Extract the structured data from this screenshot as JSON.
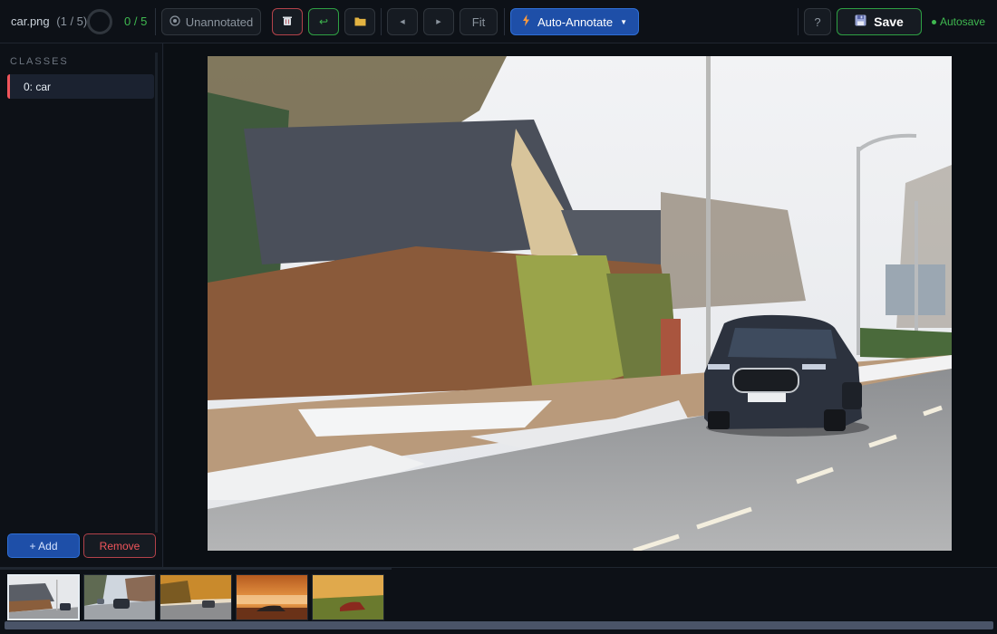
{
  "toolbar": {
    "filename": "car.png",
    "file_index": "(1 / 5)",
    "progress": "0 / 5",
    "unannotated_label": "Unannotated",
    "fit_label": "Fit",
    "auto_annotate_label": "Auto-Annotate",
    "help_label": "?",
    "save_label": "Save",
    "autosave_label": "Autosave"
  },
  "sidebar": {
    "title": "CLASSES",
    "classes": [
      {
        "label": "0: car",
        "color": "#f0555b"
      }
    ],
    "add_label": "+ Add",
    "remove_label": "Remove"
  },
  "canvas": {
    "image": "car.png"
  },
  "filmstrip": {
    "thumbnails": [
      {
        "scene": "suburban street with car",
        "active": true
      },
      {
        "scene": "city street with cars",
        "active": false
      },
      {
        "scene": "autumn road with car",
        "active": false
      },
      {
        "scene": "sunset car",
        "active": false
      },
      {
        "scene": "car on grass field",
        "active": false
      }
    ]
  },
  "colors": {
    "accent_blue": "#1e4fa8",
    "danger_red": "#f0555b",
    "success_green": "#3fb950",
    "background": "#0d1117"
  }
}
